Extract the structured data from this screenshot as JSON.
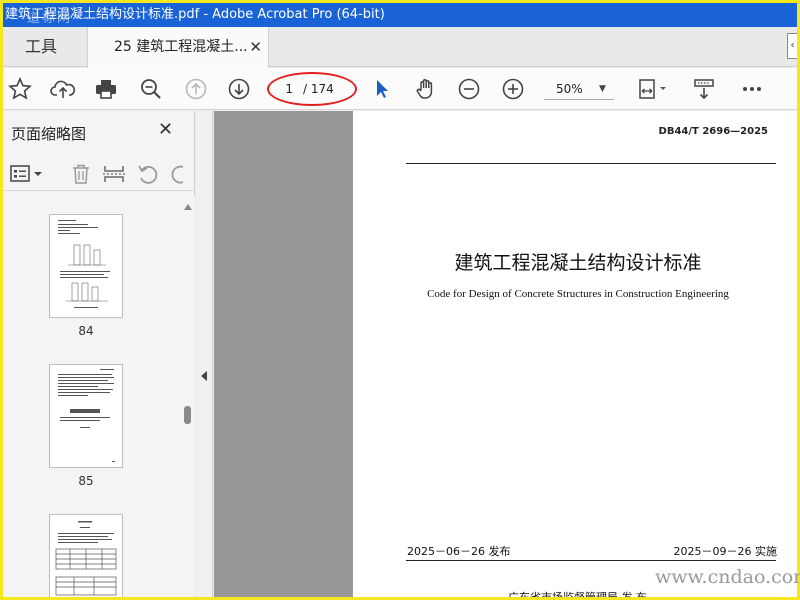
{
  "window": {
    "title": "建筑工程混凝土结构设计标准.pdf - Adobe Acrobat Pro (64-bit)"
  },
  "tabs": {
    "tools_label": "工具",
    "doc_label": "25 建筑工程混凝土...",
    "close_glyph": "✕"
  },
  "toolbar": {
    "current_page": "1",
    "total_pages": "/ 174",
    "zoom": "50%"
  },
  "sidebar": {
    "title": "页面缩略图",
    "close_glyph": "✕",
    "thumbnails": [
      {
        "label": "84"
      },
      {
        "label": "85"
      },
      {
        "label": ""
      }
    ]
  },
  "document": {
    "standard_code": "DB44/T 2696—2025",
    "title_cn": "建筑工程混凝土结构设计标准",
    "title_en": "Code for Design of Concrete Structures in Construction Engineering",
    "issue_date": "2025－06－26 发布",
    "effective_date": "2025－09－26 实施",
    "issuer": "广东省市场监督管理局    发  布"
  },
  "watermarks": {
    "url": "www.cndao.com",
    "top_left": "道标网"
  },
  "colors": {
    "titlebar": "#1a63d6",
    "frame_border": "#f5e71d",
    "annotation": "#e02020",
    "cursor_blue": "#1a5fc4"
  }
}
